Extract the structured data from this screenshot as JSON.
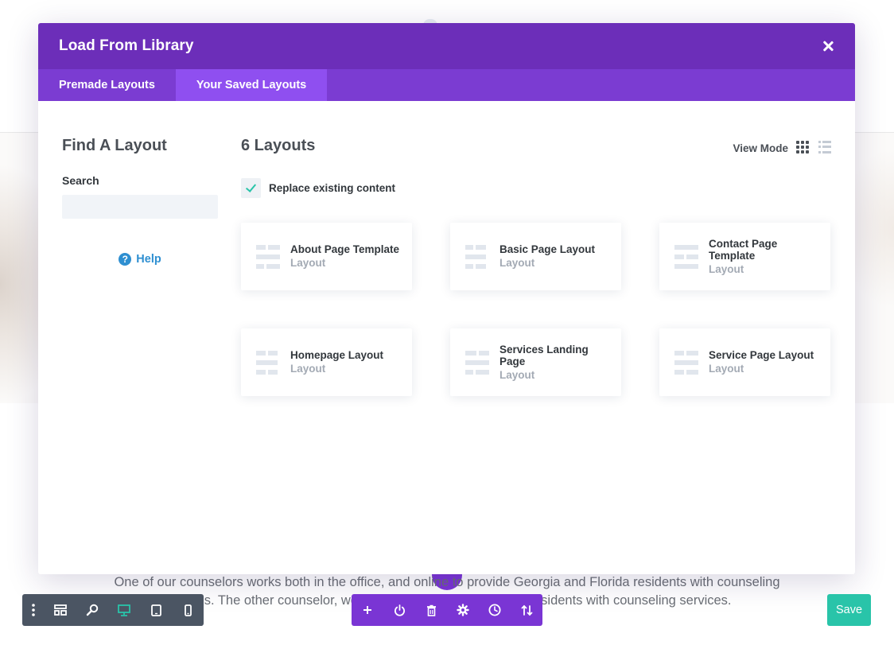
{
  "background": {
    "text_line_1": "One of our counselors works both in the office, and online to provide Georgia and Florida residents with counseling",
    "text_line_2": "services. The other counselor, works online to provide Georgia residents with counseling services."
  },
  "modal": {
    "title": "Load From Library",
    "close_icon": "close-icon",
    "tabs": [
      {
        "label": "Premade Layouts",
        "active": false
      },
      {
        "label": "Your Saved Layouts",
        "active": true
      }
    ]
  },
  "sidebar": {
    "title": "Find A Layout",
    "search_label": "Search",
    "search_value": "",
    "help_label": "Help",
    "help_icon": "question-circle-icon"
  },
  "main": {
    "count_title": "6 Layouts",
    "view_mode_label": "View Mode",
    "view_mode_icons": [
      "grid-view-icon",
      "list-view-icon"
    ],
    "replace_label": "Replace existing content",
    "replace_checked": true,
    "layouts": [
      {
        "name": "About Page Template",
        "type": "Layout"
      },
      {
        "name": "Basic Page Layout",
        "type": "Layout"
      },
      {
        "name": "Contact Page Template",
        "type": "Layout"
      },
      {
        "name": "Homepage Layout",
        "type": "Layout"
      },
      {
        "name": "Services Landing Page",
        "type": "Layout"
      },
      {
        "name": "Service Page Layout",
        "type": "Layout"
      }
    ]
  },
  "toolbar": {
    "left_icons": [
      "more-vertical-icon",
      "wireframe-icon",
      "zoom-icon",
      "desktop-icon",
      "tablet-icon",
      "phone-icon"
    ],
    "center_icons": [
      "plus-icon",
      "power-icon",
      "trash-icon",
      "settings-icon",
      "history-icon",
      "portability-icon"
    ],
    "save_label": "Save"
  },
  "colors": {
    "header_purple": "#6c2eb9",
    "tab_bar_purple": "#7b3cd2",
    "active_tab_purple": "#8f4ff0",
    "teal_accent": "#29c4a9",
    "help_blue": "#2e8fd1",
    "dark_toolbar": "#4b5563"
  }
}
